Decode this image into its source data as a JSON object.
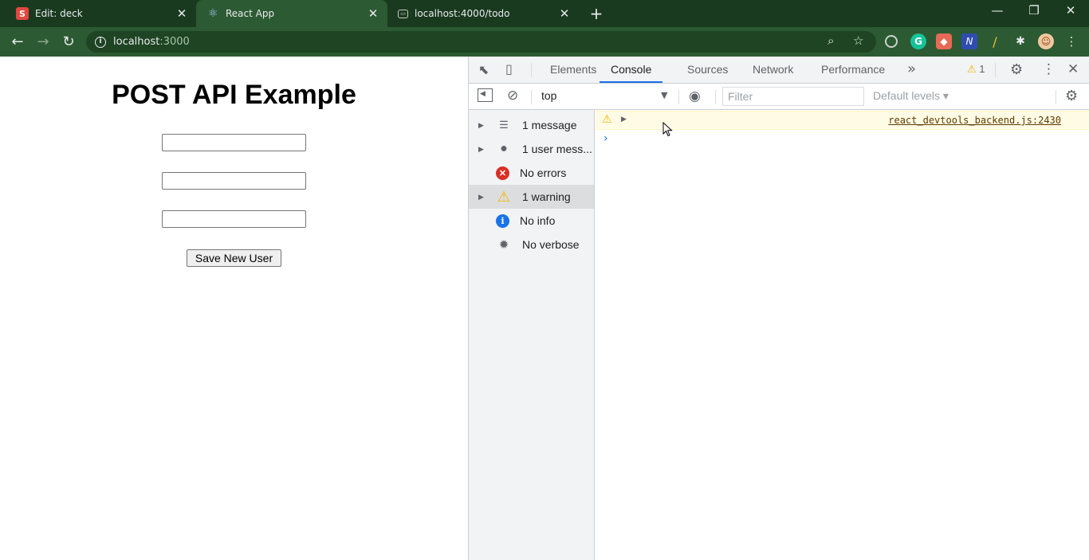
{
  "browser": {
    "tabs": [
      {
        "title": "Edit: deck",
        "favicon": "slides-icon",
        "favicon_text": "S"
      },
      {
        "title": "React App",
        "favicon": "react-icon",
        "favicon_text": "⚛"
      },
      {
        "title": "localhost:4000/todo",
        "favicon": "page-icon",
        "favicon_text": "▭"
      }
    ],
    "new_tab": "+",
    "window_controls": {
      "minimize": "—",
      "restore": "❐",
      "close": "✕"
    },
    "address": {
      "host": "localhost",
      "port": ":3000"
    }
  },
  "page": {
    "heading": "POST API Example",
    "inputs": [
      "",
      "",
      ""
    ],
    "button_label": "Save New User"
  },
  "devtools": {
    "tabs": [
      "Elements",
      "Console",
      "Sources",
      "Network",
      "Performance"
    ],
    "active_tab": "Console",
    "more_tabs": "»",
    "warning_count": "1",
    "context": "top",
    "filter_placeholder": "Filter",
    "levels": "Default levels ▾",
    "sidebar": [
      {
        "label": "1 message",
        "icon": "list-icon",
        "expandable": true
      },
      {
        "label": "1 user mess...",
        "icon": "user-icon",
        "expandable": true
      },
      {
        "label": "No errors",
        "icon": "error-icon",
        "expandable": false
      },
      {
        "label": "1 warning",
        "icon": "warning-icon",
        "expandable": true,
        "selected": true
      },
      {
        "label": "No info",
        "icon": "info-icon",
        "expandable": false
      },
      {
        "label": "No verbose",
        "icon": "bug-icon",
        "expandable": false
      }
    ],
    "messages": [
      {
        "level": "warning",
        "text": "",
        "source": "react_devtools_backend.js:2430"
      }
    ],
    "prompt": "›"
  },
  "colors": {
    "tabstrip": "#1a3a20",
    "toolbar": "#2c5a32",
    "accent": "#1a73e8",
    "warning": "#f5b400",
    "error": "#d93025"
  }
}
